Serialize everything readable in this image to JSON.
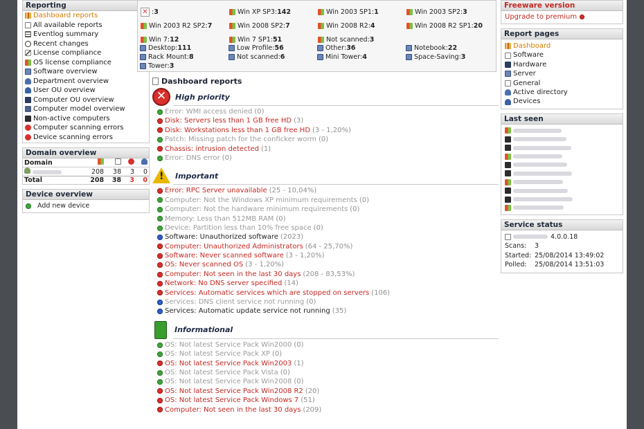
{
  "reporting": {
    "title": "Reporting",
    "items": [
      {
        "label": "Dashboard reports",
        "icon": "chart-icon",
        "active": true
      },
      {
        "label": "All available reports",
        "icon": "document-icon"
      },
      {
        "label": "Eventlog summary",
        "icon": "list-icon"
      },
      {
        "label": "Recent changes",
        "icon": "clock-icon"
      },
      {
        "label": "License compliance",
        "icon": "pen-icon"
      },
      {
        "label": "OS license compliance",
        "icon": "windows-icon"
      },
      {
        "label": "Software overview",
        "icon": "monitor-icon"
      },
      {
        "label": "Department overview",
        "icon": "people-icon"
      },
      {
        "label": "User OU overview",
        "icon": "user-icon"
      },
      {
        "label": "Computer OU overview",
        "icon": "computer-icon"
      },
      {
        "label": "Computer model overview",
        "icon": "computer-model-icon"
      },
      {
        "label": "Non-active computers",
        "icon": "power-off-icon"
      },
      {
        "label": "Computer scanning errors",
        "icon": "error-icon"
      },
      {
        "label": "Device scanning errors",
        "icon": "error-icon"
      }
    ]
  },
  "domain_overview": {
    "title": "Domain overview",
    "col_domain": "Domain",
    "row": {
      "c1": "208",
      "c2": "38",
      "c3": "3",
      "c4": "0"
    },
    "total": {
      "label": "Total",
      "c1": "208",
      "c2": "38",
      "c3": "3",
      "c4": "0"
    }
  },
  "device_overview": {
    "title": "Device overview",
    "add_label": "Add new device"
  },
  "os_counts": {
    "rows": [
      [
        {
          "label": "",
          "value": "3",
          "icon": "x"
        },
        {
          "label": "Win XP SP3",
          "value": "142"
        },
        {
          "label": "Win 2003 SP1",
          "value": "1"
        },
        {
          "label": "Win 2003 SP2",
          "value": "3"
        }
      ],
      [
        {
          "label": "Win 2003 R2 SP2",
          "value": "7"
        },
        {
          "label": "Win 2008 SP2",
          "value": "7"
        },
        {
          "label": "Win 2008 R2",
          "value": "4"
        },
        {
          "label": "Win 2008 R2 SP1",
          "value": "20"
        }
      ],
      [
        {
          "label": "Win 7",
          "value": "12"
        },
        {
          "label": "Win 7 SP1",
          "value": "51"
        },
        {
          "label": "Not scanned",
          "value": "3"
        },
        {
          "label": "",
          "value": ""
        }
      ]
    ]
  },
  "device_types": {
    "rows": [
      [
        {
          "label": "Desktop",
          "value": "111"
        },
        {
          "label": "Low Profile",
          "value": "56"
        },
        {
          "label": "Other",
          "value": "36"
        },
        {
          "label": "Notebook",
          "value": "22"
        }
      ],
      [
        {
          "label": "Rack Mount",
          "value": "8"
        },
        {
          "label": "Not scanned",
          "value": "6"
        },
        {
          "label": "Mini Tower",
          "value": "4"
        },
        {
          "label": "Space-Saving",
          "value": "3"
        }
      ],
      [
        {
          "label": "Tower",
          "value": "3"
        }
      ]
    ]
  },
  "dashboard": {
    "title": "Dashboard reports",
    "high_priority": {
      "title": "High priority",
      "items": [
        {
          "label": "Error: WMI access denied",
          "count": "(0)",
          "status": "green",
          "tone": "gray"
        },
        {
          "label": "Disk: Servers less than 1 GB free HD",
          "count": "(3)",
          "status": "red",
          "tone": "red"
        },
        {
          "label": "Disk: Workstations less than 1 GB free HD",
          "count": "(3 - 1,20%)",
          "status": "red",
          "tone": "red"
        },
        {
          "label": "Patch: Missing patch for the conficker worm",
          "count": "(0)",
          "status": "green",
          "tone": "gray"
        },
        {
          "label": "Chassis: intrusion detected",
          "count": "(1)",
          "status": "red",
          "tone": "red"
        },
        {
          "label": "Error: DNS error",
          "count": "(0)",
          "status": "green",
          "tone": "gray"
        }
      ]
    },
    "important": {
      "title": "Important",
      "items": [
        {
          "label": "Error: RPC Server unavailable",
          "count": "(25 - 10,04%)",
          "status": "red",
          "tone": "red"
        },
        {
          "label": "Computer: Not the Windows XP minimum requirements",
          "count": "(0)",
          "status": "green",
          "tone": "gray"
        },
        {
          "label": "Computer: Not the hardware minimum requirements",
          "count": "(0)",
          "status": "green",
          "tone": "gray"
        },
        {
          "label": "Memory: Less than 512MB RAM",
          "count": "(0)",
          "status": "green",
          "tone": "gray"
        },
        {
          "label": "Device: Partition less than 10% free space",
          "count": "(0)",
          "status": "green",
          "tone": "gray"
        },
        {
          "label": "Software: Unauthorized software",
          "count": "(2023)",
          "status": "blue",
          "tone": "dark"
        },
        {
          "label": "Computer: Unauthorized Administrators",
          "count": "(64 - 25,70%)",
          "status": "red",
          "tone": "red"
        },
        {
          "label": "Software: Never scanned software",
          "count": "(3 - 1,20%)",
          "status": "red",
          "tone": "red"
        },
        {
          "label": "OS: Never scanned OS",
          "count": "(3 - 1,20%)",
          "status": "red",
          "tone": "red"
        },
        {
          "label": "Computer: Not seen in the last 30 days",
          "count": "(208 - 83,53%)",
          "status": "red",
          "tone": "red"
        },
        {
          "label": "Network: No DNS server specified",
          "count": "(14)",
          "status": "red",
          "tone": "red"
        },
        {
          "label": "Services: Automatic services which are stopped on servers",
          "count": "(106)",
          "status": "red",
          "tone": "red"
        },
        {
          "label": "Services: DNS client service not running",
          "count": "(0)",
          "status": "blue",
          "tone": "gray"
        },
        {
          "label": "Services: Automatic update service not running",
          "count": "(35)",
          "status": "blue",
          "tone": "dark"
        }
      ]
    },
    "informational": {
      "title": "Informational",
      "items": [
        {
          "label": "OS: Not latest Service Pack Win2000",
          "count": "(0)",
          "status": "green",
          "tone": "gray"
        },
        {
          "label": "OS: Not latest Service Pack XP",
          "count": "(0)",
          "status": "green",
          "tone": "gray"
        },
        {
          "label": "OS: Not latest Service Pack Win2003",
          "count": "(1)",
          "status": "red",
          "tone": "red"
        },
        {
          "label": "OS: Not latest Service Pack Vista",
          "count": "(0)",
          "status": "green",
          "tone": "gray"
        },
        {
          "label": "OS: Not latest Service Pack Win2008",
          "count": "(0)",
          "status": "green",
          "tone": "gray"
        },
        {
          "label": "OS: Not latest Service Pack Win2008 R2",
          "count": "(20)",
          "status": "red",
          "tone": "red"
        },
        {
          "label": "OS: Not latest Service Pack Windows 7",
          "count": "(51)",
          "status": "red",
          "tone": "red"
        },
        {
          "label": "Computer: Not seen in the last 30 days",
          "count": "(209)",
          "status": "red",
          "tone": "red"
        }
      ]
    }
  },
  "freeware": {
    "title": "Freeware version",
    "upgrade": "Upgrade to premium"
  },
  "report_pages": {
    "title": "Report pages",
    "items": [
      {
        "label": "Dashboard",
        "active": true,
        "icon": "chart-icon"
      },
      {
        "label": "Software",
        "icon": "software-icon"
      },
      {
        "label": "Hardware",
        "icon": "hardware-icon"
      },
      {
        "label": "Server",
        "icon": "server-icon"
      },
      {
        "label": "General",
        "icon": "general-icon"
      },
      {
        "label": "Active directory",
        "icon": "active-directory-icon"
      },
      {
        "label": "Devices",
        "icon": "devices-icon"
      }
    ]
  },
  "last_seen": {
    "title": "Last seen",
    "count": 10
  },
  "service_status": {
    "title": "Service status",
    "version": "4.0.0.18",
    "scans_label": "Scans:",
    "scans_value": "3",
    "started_label": "Started:",
    "started_value": "25/08/2014 13:49:02",
    "polled_label": "Polled:",
    "polled_value": "25/08/2014 13:51:03"
  },
  "colors": {
    "accent_orange": "#d77a00",
    "error_red": "#c42822",
    "ok_green": "#3fa53a",
    "info_blue": "#2f5ecb"
  }
}
